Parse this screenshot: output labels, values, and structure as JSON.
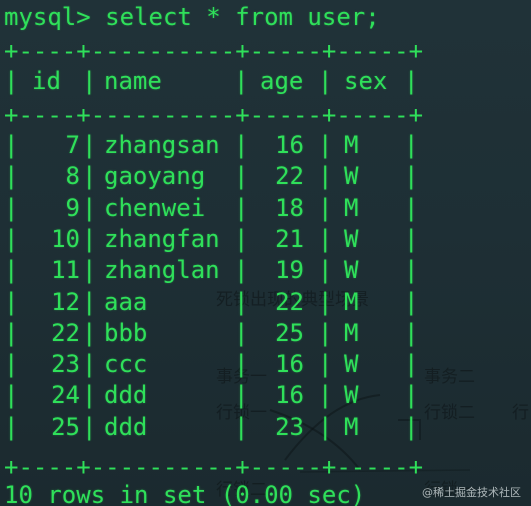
{
  "terminal": {
    "prompt": "mysql> select * from user;",
    "separator": "+----+----------+-----+-----+",
    "columns": {
      "id": "id",
      "name": "name",
      "age": "age",
      "sex": "sex"
    },
    "rows": [
      {
        "id": "7",
        "name": "zhangsan",
        "age": "16",
        "sex": "M"
      },
      {
        "id": "8",
        "name": "gaoyang",
        "age": "22",
        "sex": "W"
      },
      {
        "id": "9",
        "name": "chenwei",
        "age": "18",
        "sex": "M"
      },
      {
        "id": "10",
        "name": "zhangfan",
        "age": "21",
        "sex": "W"
      },
      {
        "id": "11",
        "name": "zhanglan",
        "age": "19",
        "sex": "W"
      },
      {
        "id": "12",
        "name": "aaa",
        "age": "22",
        "sex": "M"
      },
      {
        "id": "22",
        "name": "bbb",
        "age": "25",
        "sex": "M"
      },
      {
        "id": "23",
        "name": "ccc",
        "age": "16",
        "sex": "W"
      },
      {
        "id": "24",
        "name": "ddd",
        "age": "16",
        "sex": "W"
      },
      {
        "id": "25",
        "name": "ddd",
        "age": "23",
        "sex": "M"
      }
    ],
    "footer": "10 rows in set (0.00 sec)",
    "text_color": "#2fe05a",
    "background_color": "#1e2f35"
  },
  "background_ghost": {
    "title": "死锁出现的典型场景",
    "tx1": "事务一",
    "tx2": "事务二",
    "lock_row1": "行锁一",
    "lock_row2": "行锁二",
    "lock_row3": "行",
    "lock_row4": "行锁二",
    "lock_row5": "行锁一"
  },
  "watermark": "@稀土掘金技术社区"
}
